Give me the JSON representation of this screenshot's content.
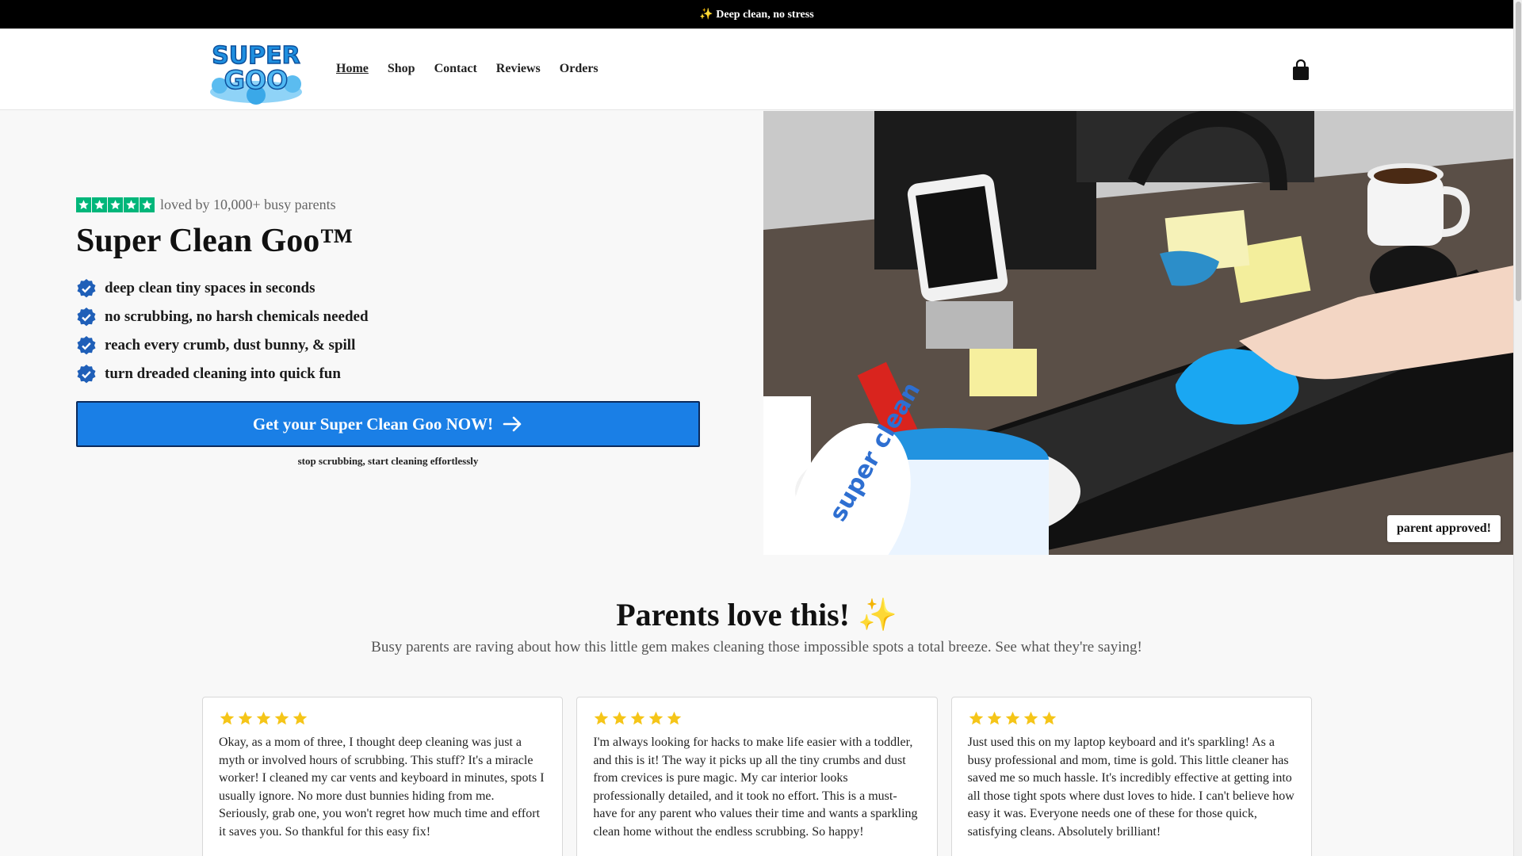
{
  "announcement": {
    "text": "✨ Deep clean, no stress"
  },
  "header": {
    "logo_text": [
      "SUPER",
      "GOO"
    ],
    "nav": [
      {
        "label": "Home",
        "active": true
      },
      {
        "label": "Shop",
        "active": false
      },
      {
        "label": "Contact",
        "active": false
      },
      {
        "label": "Reviews",
        "active": false
      },
      {
        "label": "Orders",
        "active": false
      }
    ],
    "cart_icon": "shopping-bag-icon"
  },
  "hero": {
    "rating_stars": 5,
    "rating_text": "loved by 10,000+ busy parents",
    "title": "Super Clean Goo™",
    "features": [
      "deep clean tiny spaces in seconds",
      "no scrubbing, no harsh chemicals needed",
      "reach every crumb, dust bunny, & spill",
      "turn dreaded cleaning into quick fun"
    ],
    "cta_label": "Get your Super Clean Goo NOW!",
    "cta_sub": "stop scrubbing, start cleaning effortlessly",
    "image_badge": "parent approved!",
    "jar_label": "super clean"
  },
  "reviews": {
    "title": "Parents love this! ✨",
    "subtitle": "Busy parents are raving about how this little gem makes cleaning those impossible spots a total breeze. See what they're saying!",
    "items": [
      {
        "stars": 5,
        "text": "Okay, as a mom of three, I thought deep cleaning was just a myth or involved hours of scrubbing. This stuff? It's a miracle worker! I cleaned my car vents and keyboard in minutes, spots I usually ignore. No more dust bunnies hiding from me. Seriously, grab one, you won't regret how much time and effort it saves you. So thankful for this easy fix!"
      },
      {
        "stars": 5,
        "text": "I'm always looking for hacks to make life easier with a toddler, and this is it! The way it picks up all the tiny crumbs and dust from crevices is pure magic. My car interior looks professionally detailed, and it took no effort. This is a must-have for any parent who values their time and wants a sparkling clean home without the endless scrubbing. So happy!"
      },
      {
        "stars": 5,
        "text": "Just used this on my laptop keyboard and it's sparkling! As a busy professional and mom, time is gold. This little cleaner has saved me so much hassle. It's incredibly effective at getting into all those tight spots where dust loves to hide. I can't believe how easy it was. Everyone needs one of these for those quick, satisfying cleans. Absolutely brilliant!"
      }
    ]
  },
  "colors": {
    "accent": "#1a7fe6",
    "trustpilot_green": "#00b67a",
    "check_blue": "#1f5fb8",
    "star_yellow": "#f5c518"
  }
}
